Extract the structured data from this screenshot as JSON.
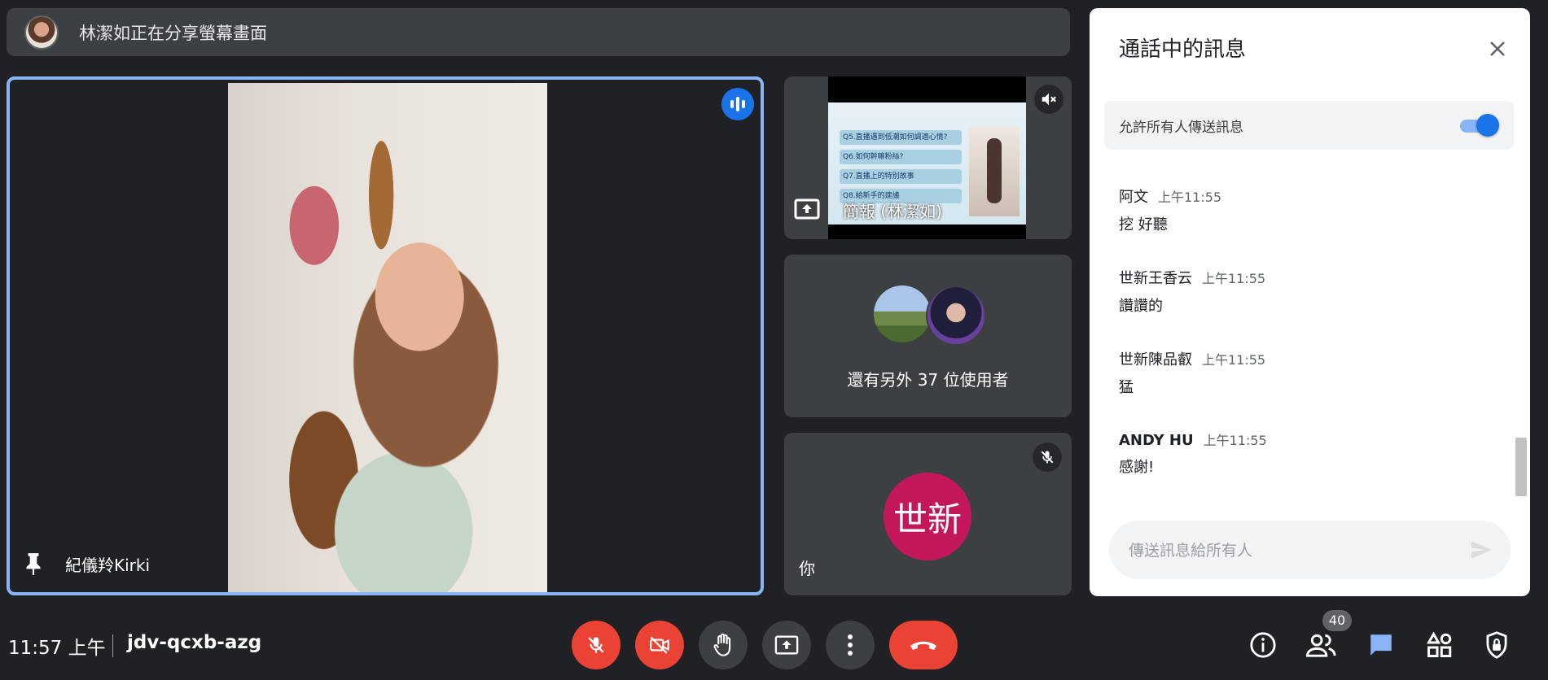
{
  "banner": {
    "text": "林潔如正在分享螢幕畫面"
  },
  "main_tile": {
    "name": "紀儀羚Kirki"
  },
  "screen_tile": {
    "caption": "簡報 (林潔如)",
    "slide_rows": [
      "Q5.直播遇到低潮如何調適心情?",
      "Q6.如何幹嘛粉絲?",
      "Q7.直播上的特別故事",
      "Q8.給新手的建議"
    ]
  },
  "others_tile": {
    "text": "還有另外 37 位使用者"
  },
  "you_tile": {
    "avatar_text": "世新",
    "label": "你"
  },
  "chat": {
    "title": "通話中的訊息",
    "allow_label": "允許所有人傳送訊息",
    "allow_enabled": true,
    "messages": [
      {
        "sender": "阿文",
        "time": "上午11:55",
        "text": "挖 好聽"
      },
      {
        "sender": "世新王香云",
        "time": "上午11:55",
        "text": "讚讚的"
      },
      {
        "sender": "世新陳品叡",
        "time": "上午11:55",
        "text": "猛"
      },
      {
        "sender": "ANDY HU",
        "time": "上午11:55",
        "text": "感謝!"
      }
    ],
    "input_placeholder": "傳送訊息給所有人"
  },
  "bottom_bar": {
    "time": "11:57 上午",
    "meeting_code": "jdv-qcxb-azg",
    "participant_count": "40",
    "controls": [
      "mic-off-icon",
      "camera-off-icon",
      "raise-hand-icon",
      "present-icon",
      "more-icon",
      "end-call-icon"
    ],
    "right_icons": [
      "info-icon",
      "people-icon",
      "chat-icon",
      "activities-icon",
      "host-controls-icon"
    ]
  },
  "colors": {
    "accent": "#1a73e8",
    "danger": "#ea4335",
    "tile": "#3c4043",
    "background": "#202124",
    "you_avatar": "#c2185b"
  }
}
